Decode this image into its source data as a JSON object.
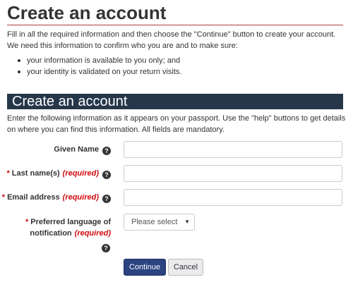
{
  "page": {
    "title": "Create an account",
    "intro": "Fill in all the required information and then choose the \"Continue\" button to create your account. We need this information to confirm who you are and to make sure:",
    "bullets": [
      "your information is available to you only; and",
      "your identity is validated on your return visits."
    ]
  },
  "section": {
    "title": "Create an account",
    "description": "Enter the following information as it appears on your passport. Use the \"help\" buttons to get details on where you can find this information. All fields are mandatory."
  },
  "form": {
    "required_marker": "*",
    "required_text": "(required)",
    "help_glyph": "?",
    "given_name": {
      "label": "Given Name",
      "value": ""
    },
    "last_name": {
      "label": "Last name(s)",
      "value": ""
    },
    "email": {
      "label": "Email address",
      "value": ""
    },
    "language": {
      "label_line1": "Preferred language of",
      "label_line2": "notification",
      "selected": "Please select",
      "caret": "▼"
    }
  },
  "actions": {
    "continue_label": "Continue",
    "cancel_label": "Cancel"
  },
  "colors": {
    "section_bar": "#26374a",
    "rule": "#af3c43",
    "required": "#d3080c",
    "primary_button": "#2b4380"
  }
}
